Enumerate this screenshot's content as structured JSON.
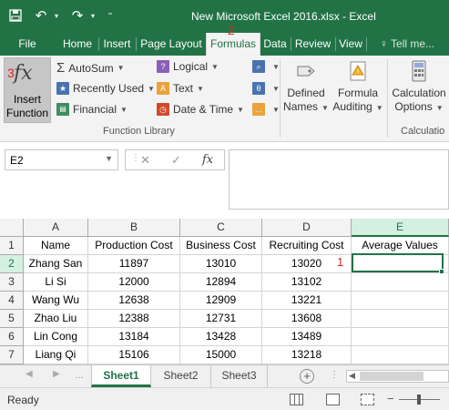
{
  "titlebar": {
    "title": "New Microsoft Excel 2016.xlsx - Excel"
  },
  "tabs": {
    "file": "File",
    "home": "Home",
    "insert": "Insert",
    "page_layout": "Page Layout",
    "formulas": "Formulas",
    "data": "Data",
    "review": "Review",
    "view": "View",
    "tell_me": "Tell me..."
  },
  "markers": {
    "step1": "1",
    "step2": "2",
    "step3": "3"
  },
  "ribbon": {
    "insert_function_line1": "Insert",
    "insert_function_line2": "Function",
    "insert_function_glyph": "fx",
    "autosum": "AutoSum",
    "recently_used": "Recently Used",
    "financial": "Financial",
    "logical": "Logical",
    "text": "Text",
    "date_time": "Date & Time",
    "defined_names_1": "Defined",
    "defined_names_2": "Names",
    "formula_auditing_1": "Formula",
    "formula_auditing_2": "Auditing",
    "calculation_1": "Calculation",
    "calculation_2": "Options",
    "group_function_library": "Function Library",
    "group_calculation": "Calculatio"
  },
  "formula_bar": {
    "name_box": "E2",
    "fx": "fx",
    "value": ""
  },
  "grid": {
    "columns": [
      "A",
      "B",
      "C",
      "D",
      "E"
    ],
    "row_numbers": [
      "1",
      "2",
      "3",
      "4",
      "5",
      "6",
      "7"
    ],
    "header_row": [
      "Name",
      "Production Cost",
      "Business Cost",
      "Recruiting Cost",
      "Average Values"
    ],
    "rows": [
      [
        "Zhang San",
        "11897",
        "13010",
        "13020",
        ""
      ],
      [
        "Li Si",
        "12000",
        "12894",
        "13102",
        ""
      ],
      [
        "Wang Wu",
        "12638",
        "12909",
        "13221",
        ""
      ],
      [
        "Zhao Liu",
        "12388",
        "12731",
        "13608",
        ""
      ],
      [
        "Lin Cong",
        "13184",
        "13428",
        "13489",
        ""
      ],
      [
        "Liang Qi",
        "15106",
        "15000",
        "13218",
        ""
      ]
    ]
  },
  "sheets": [
    "Sheet1",
    "Sheet2",
    "Sheet3"
  ],
  "status": {
    "text": "Ready"
  },
  "colors": {
    "excel_green": "#217346",
    "marker_red": "#d9261c"
  }
}
